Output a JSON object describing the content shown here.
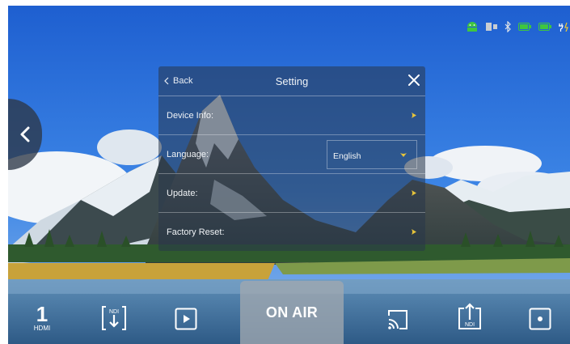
{
  "status_icons": [
    "android-icon",
    "sim-card-icon",
    "bluetooth-icon",
    "battery-icon",
    "battery-icon",
    "power-plug-icon"
  ],
  "colors": {
    "accent": "#e6c33a",
    "status_green": "#3fc63f",
    "on_air_bg": "#a0a8b0"
  },
  "dialog": {
    "back_label": "Back",
    "title": "Setting",
    "rows": [
      {
        "label": "Device Info:"
      },
      {
        "label": "Language:",
        "value": "English"
      },
      {
        "label": "Update:"
      },
      {
        "label": "Factory Reset:"
      }
    ]
  },
  "toolbar": {
    "input_number": "1",
    "input_label": "HDMI",
    "ndi_in_label": "NDI",
    "on_air_label": "ON AIR",
    "ndi_out_label": "NDI"
  }
}
